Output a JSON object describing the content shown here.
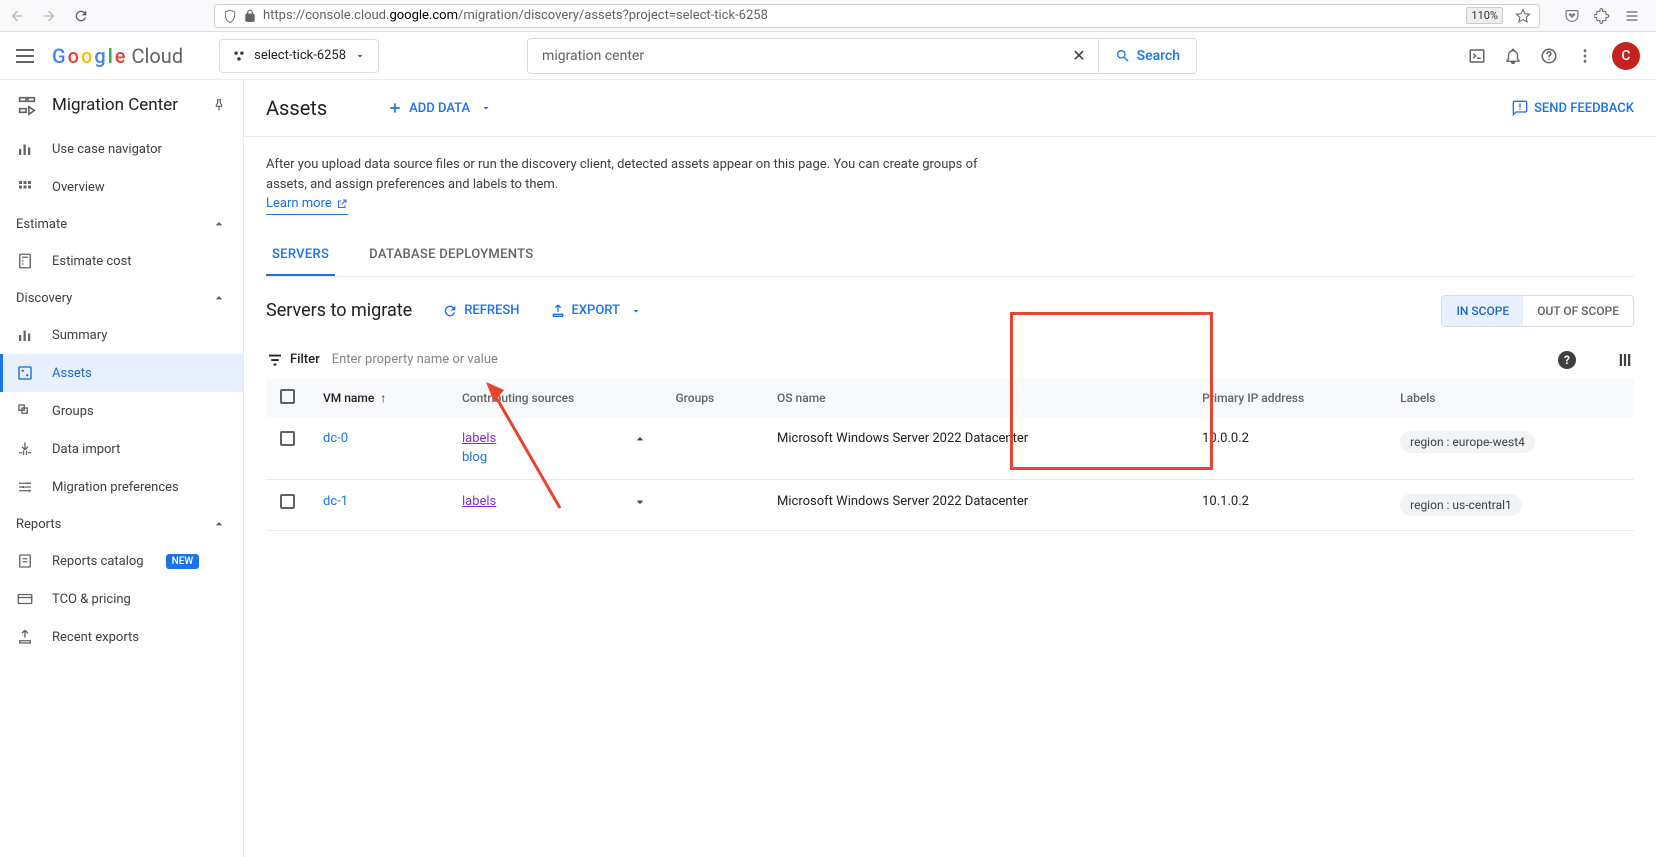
{
  "browser": {
    "url_prefix": "https://console.cloud.",
    "url_domain": "google.com",
    "url_path": "/migration/discovery/assets?project=select-tick-6258",
    "zoom": "110%"
  },
  "appbar": {
    "project": "select-tick-6258",
    "search_value": "migration center",
    "search_button": "Search",
    "avatar_letter": "C"
  },
  "sidebar": {
    "product_title": "Migration Center",
    "items": [
      {
        "label": "Use case navigator"
      },
      {
        "label": "Overview"
      }
    ],
    "estimate_header": "Estimate",
    "estimate_items": [
      {
        "label": "Estimate cost"
      }
    ],
    "discovery_header": "Discovery",
    "discovery_items": [
      {
        "label": "Summary"
      },
      {
        "label": "Assets"
      },
      {
        "label": "Groups"
      },
      {
        "label": "Data import"
      },
      {
        "label": "Migration preferences"
      }
    ],
    "reports_header": "Reports",
    "reports_items": [
      {
        "label": "Reports catalog",
        "badge": "NEW"
      },
      {
        "label": "TCO & pricing"
      },
      {
        "label": "Recent exports"
      }
    ]
  },
  "page": {
    "title": "Assets",
    "add_data": "ADD DATA",
    "feedback": "SEND FEEDBACK",
    "intro": "After you upload data source files or run the discovery client, detected assets appear on this page. You can create groups of assets, and assign preferences and labels to them.",
    "learn_more": "Learn more",
    "tabs": {
      "servers": "SERVERS",
      "db": "DATABASE DEPLOYMENTS"
    },
    "sub_title": "Servers to migrate",
    "refresh": "REFRESH",
    "export": "EXPORT",
    "in_scope": "IN SCOPE",
    "out_scope": "OUT OF SCOPE",
    "filter_label": "Filter",
    "filter_placeholder": "Enter property name or value"
  },
  "table": {
    "cols": {
      "vm": "VM name",
      "sources": "Contributing sources",
      "groups": "Groups",
      "os": "OS name",
      "ip": "Primary IP address",
      "labels": "Labels"
    },
    "rows": [
      {
        "vm": "dc-0",
        "sources": [
          "labels",
          "blog"
        ],
        "expanded": true,
        "os": "Microsoft Windows Server 2022 Datacenter",
        "ip": "10.0.0.2",
        "label": "region : europe-west4"
      },
      {
        "vm": "dc-1",
        "sources": [
          "labels"
        ],
        "expanded": false,
        "os": "Microsoft Windows Server 2022 Datacenter",
        "ip": "10.1.0.2",
        "label": "region : us-central1"
      }
    ]
  }
}
